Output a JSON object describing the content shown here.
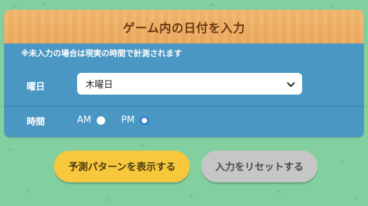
{
  "panel": {
    "title": "ゲーム内の日付を入力",
    "note": "※未入力の場合は現実の時間で計測されます"
  },
  "weekday": {
    "label": "曜日",
    "selected": "木曜日"
  },
  "time": {
    "label": "時間",
    "am_label": "AM",
    "pm_label": "PM",
    "selected": "PM"
  },
  "buttons": {
    "show_pattern": "予測パターンを表示する",
    "reset": "入力をリセットする"
  },
  "colors": {
    "background": "#84cfa0",
    "header": "#eca95d",
    "panel_body": "#4a97c3",
    "primary_button": "#f7c83b",
    "secondary_button": "#c6c6c6"
  }
}
